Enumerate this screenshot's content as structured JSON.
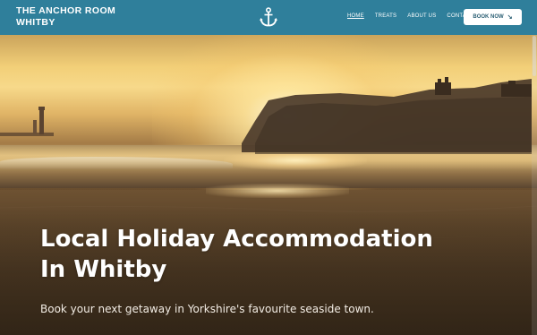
{
  "header": {
    "brand_line1": "THE ANCHOR ROOM",
    "brand_line2": "WHITBY",
    "logo_icon": "anchor-icon",
    "nav": [
      {
        "label": "HOME",
        "active": true
      },
      {
        "label": "TREATS",
        "active": false
      },
      {
        "label": "ABOUT US",
        "active": false
      },
      {
        "label": "CONTACT",
        "active": false
      }
    ],
    "book_button": {
      "label": "BOOK NOW",
      "icon": "arrow-down-right-icon"
    },
    "background_color": "#2f7f9b"
  },
  "hero": {
    "headline_line1": "Local Holiday Accommodation",
    "headline_line2": "In Whitby",
    "subheadline": "Book your next getaway in Yorkshire's favourite seaside town."
  }
}
